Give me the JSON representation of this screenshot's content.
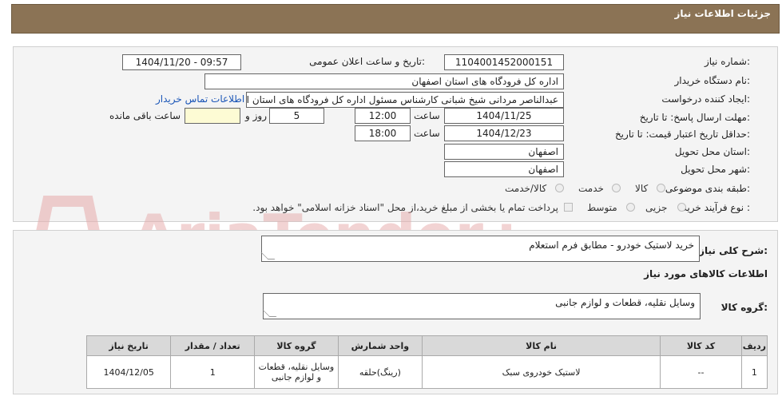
{
  "header": {
    "title": "جزئیات اطلاعات نیاز"
  },
  "form": {
    "need_number_label": "شماره نیاز:",
    "need_number": "1104001452000151",
    "announce_label": "تاریخ و ساعت اعلان عمومی:",
    "announce_value": "1404/11/20 - 09:57",
    "buyer_org_label": "نام دستگاه خریدار:",
    "buyer_org": "اداره کل فرودگاه های استان اصفهان",
    "creator_label": "ایجاد کننده درخواست:",
    "creator": "عبدالناصر مردانی شیخ شبانی کارشناس مسئول  اداره کل فرودگاه های استان اصفهان",
    "contact_link": "اطلاعات تماس خریدار",
    "reply_deadline_label": "مهلت ارسال پاسخ: تا تاریخ:",
    "reply_date": "1404/11/25",
    "time_label": "ساعت",
    "reply_time": "12:00",
    "days_value": "5",
    "days_label": "روز و",
    "remaining_value": "",
    "remaining_label": "ساعت باقی مانده",
    "price_validity_label": "حداقل تاریخ اعتبار قیمت: تا تاریخ:",
    "price_date": "1404/12/23",
    "price_time_label": "ساعت",
    "price_time": "18:00",
    "province_label": "استان محل تحویل:",
    "province": "اصفهان",
    "city_label": "شهر محل تحویل:",
    "city": "اصفهان",
    "category_label": "طبقه بندی موضوعی:",
    "category_options": [
      "کالا",
      "خدمت",
      "کالا/خدمت"
    ],
    "category_selected": "کالا",
    "process_label": "نوع فرآیند خرید :",
    "process_options": [
      "جزیی",
      "متوسط"
    ],
    "payment_note": "پرداخت تمام یا بخشی از مبلغ خرید،از محل \"اسناد خزانه اسلامی\" خواهد بود."
  },
  "details": {
    "description_label": "شرح کلی نیاز:",
    "description": "خرید لاستیک خودرو - مطابق فرم استعلام",
    "goods_info_title": "اطلاعات کالاهای مورد نیاز",
    "goods_group_label": "گروه کالا:",
    "goods_group": "وسایل نقلیه، قطعات و لوازم جانبی"
  },
  "table": {
    "headers": [
      "ردیف",
      "کد کالا",
      "نام کالا",
      "واحد شمارش",
      "گروه کالا",
      "تعداد / مقدار",
      "تاریخ نیاز"
    ],
    "rows": [
      [
        "1",
        "--",
        "لاستیک خودروی سبک",
        "(رینگ)حلقه",
        "وسایل نقلیه، قطعات و لوازم جانبی",
        "1",
        "1404/12/05"
      ]
    ]
  },
  "watermark": {
    "text": "AriaTender.neT"
  },
  "colors": {
    "header_bg": "#8b7355",
    "link": "#1a55b7",
    "watermark": "#e6a9a9"
  }
}
